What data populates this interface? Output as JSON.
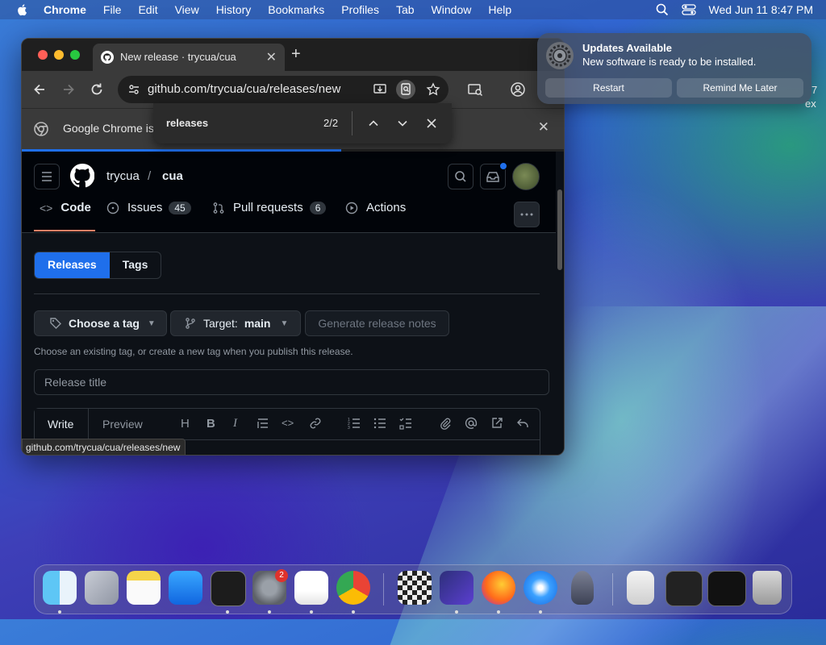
{
  "menubar": {
    "app_name": "Chrome",
    "items": [
      "File",
      "Edit",
      "View",
      "History",
      "Bookmarks",
      "Profiles",
      "Tab",
      "Window",
      "Help"
    ],
    "datetime": "Wed Jun 11  8:47 PM"
  },
  "browser": {
    "tab_title": "New release · trycua/cua",
    "url": "github.com/trycua/cua/releases/new",
    "infobar_text": "Google Chrome isn",
    "status_url": "github.com/trycua/cua/releases/new",
    "load_progress_pct": 59
  },
  "findbar": {
    "query": "releases",
    "count": "2/2"
  },
  "github": {
    "owner": "trycua",
    "separator": "/",
    "repo": "cua",
    "tabs": {
      "code": "Code",
      "issues": "Issues",
      "issues_count": "45",
      "pulls": "Pull requests",
      "pulls_count": "6",
      "actions": "Actions"
    },
    "segment": {
      "releases": "Releases",
      "tags": "Tags"
    },
    "choose_tag": "Choose a tag",
    "target_label": "Target:",
    "target_value": "main",
    "generate_notes": "Generate release notes",
    "tag_hint": "Choose an existing tag, or create a new tag when you publish this release.",
    "title_placeholder": "Release title",
    "editor": {
      "write": "Write",
      "preview": "Preview",
      "heading": "H"
    }
  },
  "notification": {
    "title": "Updates Available",
    "body": "New software is ready to be installed.",
    "restart": "Restart",
    "remind": "Remind Me Later"
  },
  "desktop": {
    "fragment1": "7",
    "fragment2": "ex"
  },
  "dock": {
    "settings_badge": "2",
    "apps": [
      "Finder",
      "Launchpad",
      "Notes",
      "App Store",
      "Terminal",
      "System Settings",
      "TextEdit",
      "Chrome",
      "Chess",
      "Shortcuts",
      "Firefox",
      "Safari",
      "Rocket",
      "Preview document",
      "Window 1",
      "Window 2",
      "Trash"
    ]
  },
  "colors": {
    "accent": "#1f6feb",
    "gh_bg": "#0d1117",
    "active_tab_underline": "#f78166"
  }
}
